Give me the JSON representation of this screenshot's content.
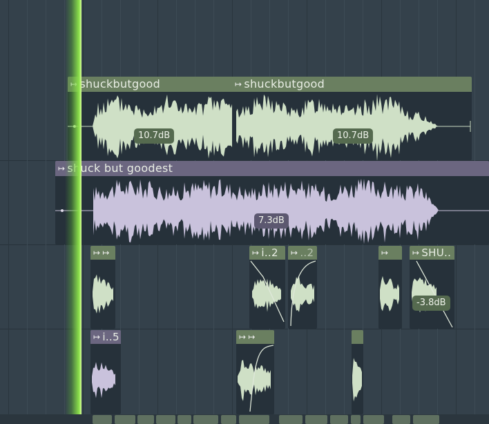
{
  "clips": {
    "shuck1": {
      "name": "shuckbutgood",
      "volume": "10.7dB"
    },
    "shuck2": {
      "name": "shuckbutgood",
      "volume": "10.7dB"
    },
    "goodest": {
      "name": "shuck but goodest",
      "volume": "7.3dB"
    },
    "small_i2": {
      "name": "i..2"
    },
    "small_dot2": {
      "name": "..2"
    },
    "small_shu": {
      "name": "SHU..",
      "volume": "-3.8dB"
    },
    "small_i5": {
      "name": "i..5"
    }
  },
  "icons": {
    "clip_icon": "↦"
  },
  "colors": {
    "track_bg": "#34414b",
    "green_clip": "#6a7f60",
    "green_wave": "#cfe0c6",
    "purple_clip": "#6b6680",
    "purple_wave": "#c9c2dc",
    "playhead": "#8be04a"
  }
}
